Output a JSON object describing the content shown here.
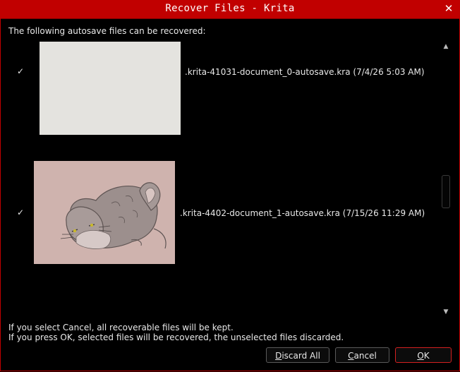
{
  "window": {
    "title": "Recover Files - Krita",
    "close_glyph": "✕"
  },
  "intro_text": "The following autosave files can be recovered:",
  "files": [
    {
      "checked_glyph": "✓",
      "name": ".krita-41031-document_0-autosave.kra  (7/4/26 5:03 AM)",
      "thumbnail": "blank-canvas",
      "thumb_color": "#e4e3df"
    },
    {
      "checked_glyph": "✓",
      "name": ".krita-4402-document_1-autosave.kra  (7/15/26 11:29 AM)",
      "thumbnail": "sleeping-cat-sketch",
      "thumb_color": "#cfb3ae"
    }
  ],
  "footer": {
    "line1": "If you select Cancel, all recoverable files will be kept.",
    "line2": "If you press OK, selected files will be recovered, the unselected files discarded."
  },
  "buttons": {
    "discard_all_mnemonic": "D",
    "discard_all_rest": "iscard All",
    "cancel_mnemonic": "C",
    "cancel_rest": "ancel",
    "ok_mnemonic": "O",
    "ok_rest": "K"
  },
  "scrollbar": {
    "up_icon": "▲",
    "down_icon": "▼"
  },
  "colors": {
    "titlebar": "#c10000",
    "background": "#000000",
    "ok_border": "#d42020"
  }
}
